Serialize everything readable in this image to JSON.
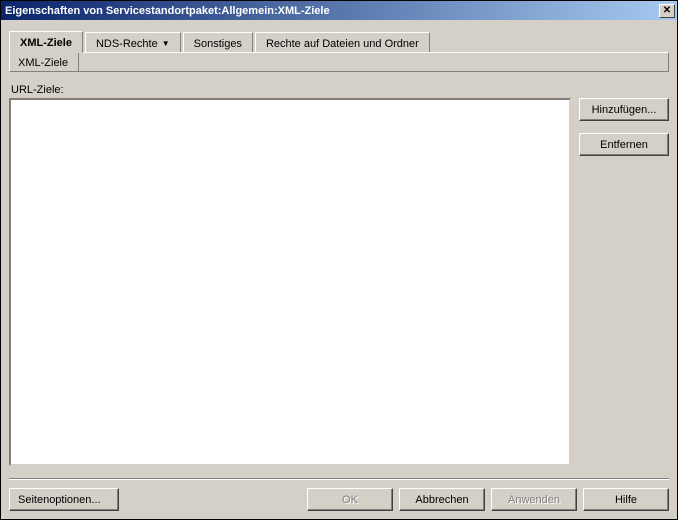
{
  "window": {
    "title": "Eigenschaften von Servicestandortpaket:Allgemein:XML-Ziele"
  },
  "tabs": [
    {
      "label": "XML-Ziele",
      "active": true
    },
    {
      "label": "NDS-Rechte",
      "hasDropdown": true
    },
    {
      "label": "Sonstiges"
    },
    {
      "label": "Rechte auf Dateien und Ordner"
    }
  ],
  "subtab": {
    "label": "XML-Ziele"
  },
  "main": {
    "list_label": "URL-Ziele:",
    "buttons": {
      "add": "Hinzufügen...",
      "remove": "Entfernen"
    }
  },
  "footer": {
    "page_options": "Seitenoptionen...",
    "ok": "OK",
    "cancel": "Abbrechen",
    "apply": "Anwenden",
    "help": "Hilfe"
  }
}
